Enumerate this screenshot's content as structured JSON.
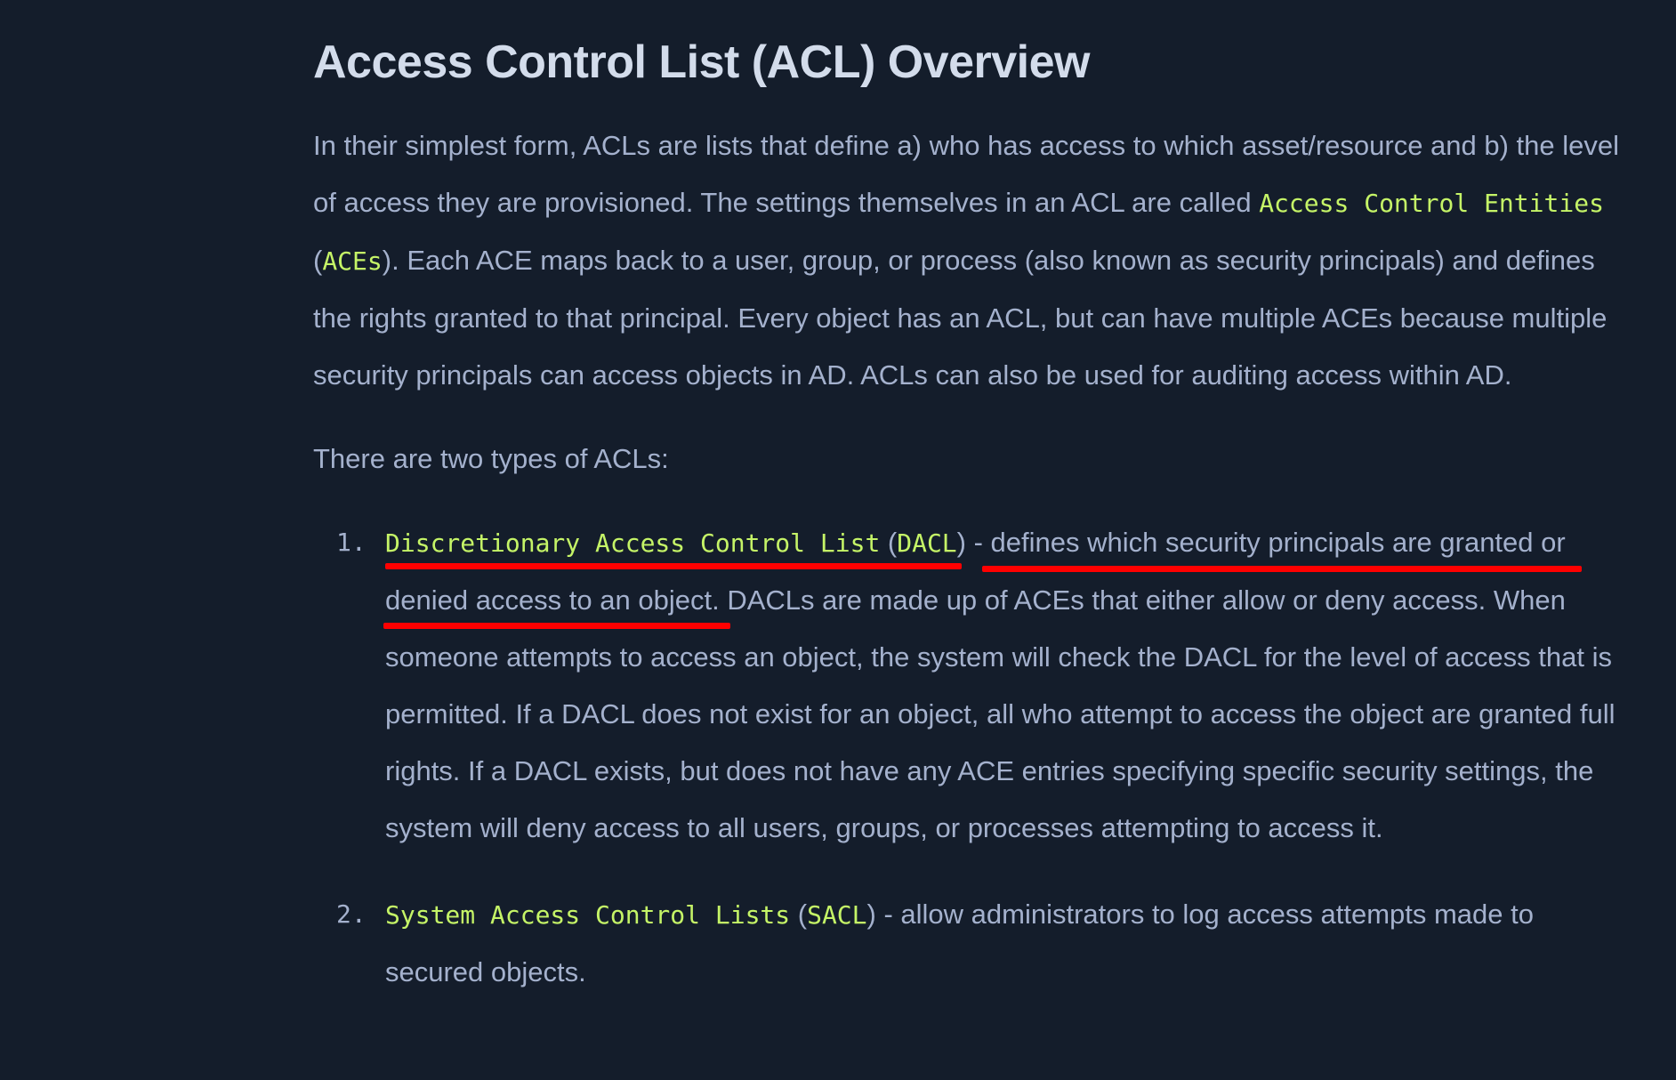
{
  "heading": "Access Control List (ACL) Overview",
  "intro": {
    "p1": "In their simplest form, ACLs are lists that define a) who has access to which asset/resource and b) the level of access they are provisioned. The settings themselves in an ACL are called ",
    "ace_term": "Access Control Entities",
    "open_paren": " (",
    "ace_abbr": "ACEs",
    "p2": "). Each ACE maps back to a user, group, or process (also known as security principals) and defines the rights granted to that principal. Every object has an ACL, but can have multiple ACEs because multiple security principals can access objects in AD. ACLs can also be used for auditing access within AD."
  },
  "types_lead": "There are two types of ACLs:",
  "list": [
    {
      "number": "1.",
      "term": "Discretionary Access Control List",
      "open_paren": " (",
      "abbr": "DACL",
      "highlight": ") - defines which security principals are granted or denied access to an object.",
      "rest": " DACLs are made up of ACEs that either allow or deny access. When someone attempts to access an object, the system will check the DACL for the level of access that is permitted. If a DACL does not exist for an object, all who attempt to access the object are granted full rights. If a DACL exists, but does not have any ACE entries specifying specific security settings, the system will deny access to all users, groups, or processes attempting to access it."
    },
    {
      "number": "2.",
      "term": "System Access Control Lists",
      "open_paren": " (",
      "abbr": "SACL",
      "text": ") - allow administrators to log access attempts made to secured objects."
    }
  ],
  "colors": {
    "background": "#141d2b",
    "body_text": "#a4b1cd",
    "heading_text": "#d3dceb",
    "code_text": "#c5f467",
    "annotation_underline": "#ff0000"
  }
}
